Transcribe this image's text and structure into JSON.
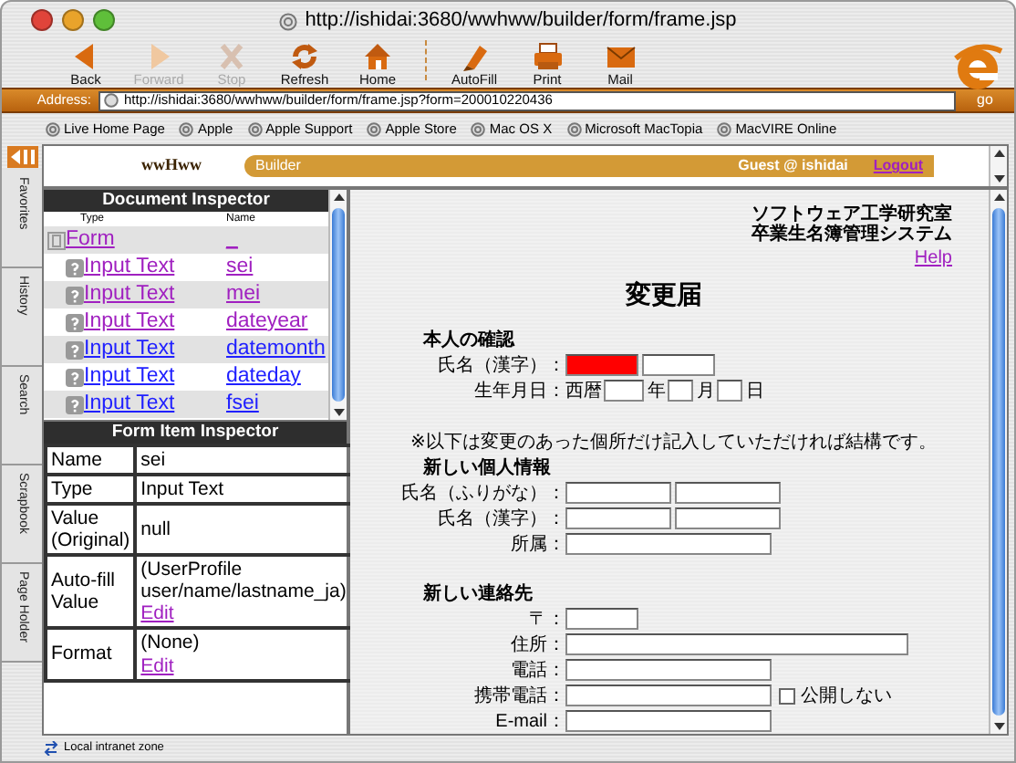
{
  "window": {
    "title": "http://ishidai:3680/wwhww/builder/form/frame.jsp"
  },
  "toolbar": [
    {
      "kind": "back",
      "label": "Back",
      "disabled": false
    },
    {
      "kind": "forward",
      "label": "Forward",
      "disabled": true
    },
    {
      "kind": "stop",
      "label": "Stop",
      "disabled": true
    },
    {
      "kind": "refresh",
      "label": "Refresh",
      "disabled": false
    },
    {
      "kind": "home",
      "label": "Home",
      "disabled": false
    },
    {
      "kind": "autofill",
      "label": "AutoFill",
      "disabled": false
    },
    {
      "kind": "print",
      "label": "Print",
      "disabled": false
    },
    {
      "kind": "mail",
      "label": "Mail",
      "disabled": false
    }
  ],
  "address": {
    "label": "Address:",
    "value": "http://ishidai:3680/wwhww/builder/form/frame.jsp?form=200010220436",
    "go": "go"
  },
  "favorites": [
    "Live Home Page",
    "Apple",
    "Apple Support",
    "Apple Store",
    "Mac OS X",
    "Microsoft MacTopia",
    "MacVIRE Online"
  ],
  "explorer_tabs": [
    "Favorites",
    "History",
    "Search",
    "Scrapbook",
    "Page Holder"
  ],
  "header": {
    "logo": "wwHww",
    "app": "Builder",
    "user": "Guest @ ishidai",
    "logout": "Logout"
  },
  "document_inspector": {
    "title": "Document Inspector",
    "columns": [
      "Type",
      "Name"
    ],
    "rows": [
      {
        "type": "Form",
        "name": "_",
        "visited": true,
        "children": [
          {
            "type": "Input Text",
            "name": "sei",
            "visited": true
          },
          {
            "type": "Input Text",
            "name": "mei",
            "visited": true
          },
          {
            "type": "Input Text",
            "name": "dateyear",
            "visited": true
          },
          {
            "type": "Input Text",
            "name": "datemonth",
            "visited": false
          },
          {
            "type": "Input Text",
            "name": "dateday",
            "visited": false
          },
          {
            "type": "Input Text",
            "name": "fsei",
            "visited": false
          }
        ]
      }
    ]
  },
  "form_item_inspector": {
    "title": "Form Item Inspector",
    "rows": [
      {
        "label": "Name",
        "value": "sei"
      },
      {
        "label": "Type",
        "value": "Input Text"
      },
      {
        "label": "Value (Original)",
        "value": "null"
      },
      {
        "label": "Auto-fill Value",
        "value": "(UserProfile user/name/lastname_ja)",
        "link": "Edit"
      },
      {
        "label": "Format",
        "value": "(None)",
        "link": "Edit"
      }
    ]
  },
  "form": {
    "org": [
      "ソフトウェア工学研究室",
      "卒業生名簿管理システム"
    ],
    "help": "Help",
    "title": "変更届",
    "sections": [
      {
        "heading": "本人の確認",
        "rows": [
          {
            "label": "氏名（漢字）：",
            "parts": [
              {
                "kind": "name",
                "error": true
              },
              {
                "kind": "name",
                "error": false
              }
            ]
          },
          {
            "label": "生年月日：",
            "parts": [
              {
                "kind": "text",
                "text": "西暦"
              },
              {
                "kind": "year",
                "error": false
              },
              {
                "kind": "text",
                "text": "年"
              },
              {
                "kind": "date",
                "error": false
              },
              {
                "kind": "text",
                "text": "月"
              },
              {
                "kind": "date",
                "error": false
              },
              {
                "kind": "text",
                "text": "日"
              }
            ]
          }
        ]
      },
      {
        "note": "※以下は変更のあった個所だけ記入していただければ結構です。",
        "heading": "新しい個人情報",
        "rows": [
          {
            "label": "氏名（ふりがな）：",
            "parts": [
              {
                "kind": "wide-name",
                "error": false
              },
              {
                "kind": "wide-name",
                "error": false
              }
            ]
          },
          {
            "label": "氏名（漢字）：",
            "parts": [
              {
                "kind": "wide-name",
                "error": false
              },
              {
                "kind": "wide-name",
                "error": false
              }
            ]
          },
          {
            "label": "所属：",
            "parts": [
              {
                "kind": "line",
                "error": false
              }
            ]
          }
        ]
      },
      {
        "heading": "新しい連絡先",
        "rows": [
          {
            "label": "〒：",
            "parts": [
              {
                "kind": "postcode",
                "error": false
              }
            ]
          },
          {
            "label": "住所：",
            "parts": [
              {
                "kind": "address",
                "error": false
              }
            ]
          },
          {
            "label": "電話：",
            "parts": [
              {
                "kind": "line",
                "error": false
              }
            ]
          },
          {
            "label": "携帯電話：",
            "parts": [
              {
                "kind": "line",
                "error": false
              },
              {
                "kind": "checkbox",
                "checked": false,
                "text": "公開しない"
              }
            ]
          },
          {
            "label": "E-mail：",
            "parts": [
              {
                "kind": "line",
                "error": false
              }
            ]
          }
        ]
      }
    ]
  },
  "status_bar": {
    "text": "Local intranet zone"
  }
}
